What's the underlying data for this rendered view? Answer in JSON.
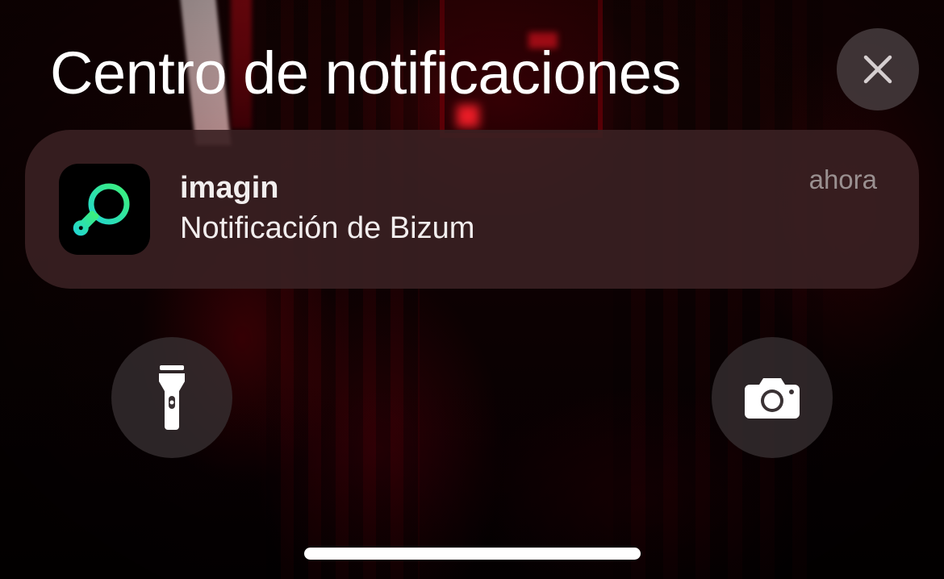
{
  "header": {
    "title": "Centro de notificaciones",
    "close_icon": "close-icon"
  },
  "notification": {
    "app_name": "imagin",
    "message": "Notificación de Bizum",
    "time": "ahora",
    "app_icon": "imagin-logo-icon",
    "accent_color": "#2ee6a8"
  },
  "quick_actions": {
    "flashlight_icon": "flashlight-icon",
    "camera_icon": "camera-icon"
  }
}
